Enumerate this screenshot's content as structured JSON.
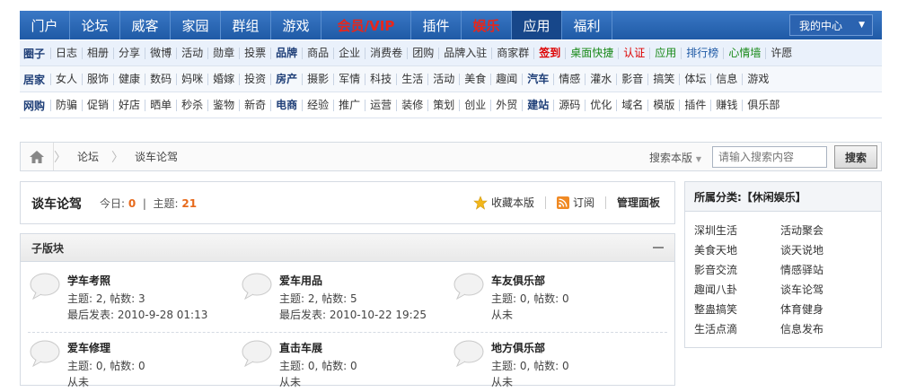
{
  "nav": {
    "items": [
      "门户",
      "论坛",
      "威客",
      "家园",
      "群组",
      "游戏",
      "会员/VIP",
      "插件",
      "娱乐",
      "应用",
      "福利"
    ],
    "my_center": "我的中心"
  },
  "subnav": {
    "row1": {
      "category": "圈子",
      "links": [
        "日志",
        "相册",
        "分享",
        "微博",
        "活动",
        "勋章",
        "投票",
        "品牌",
        "商品",
        "企业",
        "消费卷",
        "团购",
        "品牌入驻",
        "商家群",
        "签到",
        "桌面快捷",
        "认证",
        "应用",
        "排行榜",
        "心情墙",
        "许愿"
      ]
    },
    "row2": {
      "category": "居家",
      "links": [
        "女人",
        "服饰",
        "健康",
        "数码",
        "妈咪",
        "婚嫁",
        "投资",
        "房产",
        "摄影",
        "军情",
        "科技",
        "生活",
        "活动",
        "美食",
        "趣闻",
        "汽车",
        "情感",
        "灌水",
        "影音",
        "搞笑",
        "体坛",
        "信息",
        "游戏"
      ]
    },
    "row3": {
      "category": "网购",
      "links": [
        "防骗",
        "促销",
        "好店",
        "晒单",
        "秒杀",
        "鉴物",
        "新奇",
        "电商",
        "经验",
        "推广",
        "运营",
        "装修",
        "策划",
        "创业",
        "外贸",
        "建站",
        "源码",
        "优化",
        "域名",
        "模版",
        "插件",
        "赚钱",
        "俱乐部"
      ]
    }
  },
  "breadcrumb": {
    "items": [
      "论坛",
      "谈车论驾"
    ]
  },
  "search": {
    "scope": "搜索本版",
    "placeholder": "请输入搜索内容",
    "button": "搜索"
  },
  "forum": {
    "title": "谈车论驾",
    "today_label": "今日:",
    "today_value": "0",
    "topics_label": "主题:",
    "topics_value": "21",
    "actions": {
      "favorite": "收藏本版",
      "subscribe": "订阅",
      "manage": "管理面板"
    }
  },
  "subforums": {
    "header": "子版块",
    "items": [
      {
        "name": "学车考照",
        "meta1": "主题: 2, 帖数: 3",
        "meta2": "最后发表: 2010-9-28 01:13"
      },
      {
        "name": "爱车用品",
        "meta1": "主题: 2, 帖数: 5",
        "meta2": "最后发表: 2010-10-22 19:25"
      },
      {
        "name": "车友俱乐部",
        "meta1": "主题: 0, 帖数: 0",
        "meta2": "从未"
      },
      {
        "name": "爱车修理",
        "meta1": "主题: 0, 帖数: 0",
        "meta2": "从未"
      },
      {
        "name": "直击车展",
        "meta1": "主题: 0, 帖数: 0",
        "meta2": "从未"
      },
      {
        "name": "地方俱乐部",
        "meta1": "主题: 0, 帖数: 0",
        "meta2": "从未"
      }
    ]
  },
  "sidebar": {
    "title": "所属分类:【休闲娱乐】",
    "items": [
      "深圳生活",
      "活动聚会",
      "美食天地",
      "谈天说地",
      "影音交流",
      "情感驿站",
      "趣闻八卦",
      "谈车论驾",
      "整蛊搞笑",
      "体育健身",
      "生活点滴",
      "信息发布"
    ]
  },
  "colors": {
    "nav_bg": "#2563b0",
    "accent_red": "#e8261b",
    "stat_orange": "#e76a1c"
  }
}
